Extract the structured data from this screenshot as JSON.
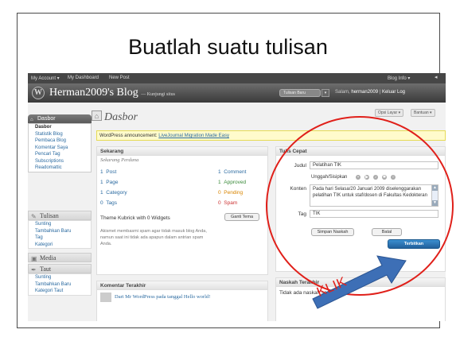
{
  "slide": {
    "title": "Buatlah suatu tulisan",
    "annotation_label": "KLIK",
    "annotation_color": "#e0201a"
  },
  "admin_bar": {
    "links": [
      "My Account ▾",
      "My Dashboard",
      "New Post"
    ],
    "right_link": "Blog Info ▾"
  },
  "header": {
    "logo_icon": "wordpress-logo-icon",
    "blog_title": "Herman2009's Blog",
    "blog_subtitle": "— Kunjungi situs",
    "quick_button": "Tulisan Baru",
    "quick_button_arrow": "▾",
    "user_greeting": "Salam,",
    "user_name": "herman2009",
    "logout": "Keluar Log"
  },
  "menu": {
    "head_label": "Dasbor",
    "items": [
      "Dasbor",
      "Statistik Blog",
      "Pembaca Blog",
      "Komentar Saya",
      "Pencari Tag",
      "Subscriptions",
      "Readomattic"
    ],
    "sections": [
      {
        "icon": "pencil-icon",
        "label": "Tulisan",
        "items": [
          "Sunting",
          "Tambahkan Baru",
          "Tag",
          "Kategori"
        ]
      },
      {
        "icon": "media-icon",
        "label": "Media",
        "items": []
      },
      {
        "icon": "pen-icon",
        "label": "Taut",
        "items": [
          "Sunting",
          "Tambahkan Baru",
          "Kategori Taut"
        ]
      }
    ]
  },
  "main": {
    "page_title": "Dasbor",
    "top_buttons": [
      "Opsi Layar ▾",
      "Bantuan ▾"
    ],
    "notice_prefix": "WordPress announcement:",
    "notice_link": "LiveJournal Migration Made Easy"
  },
  "now_box": {
    "title": "Sekarang",
    "subtitle": "Sekarang Perdana",
    "left_rows": [
      {
        "count": "1",
        "label": "Post"
      },
      {
        "count": "1",
        "label": "Page"
      },
      {
        "count": "1",
        "label": "Category"
      },
      {
        "count": "0",
        "label": "Tags"
      }
    ],
    "right_rows": [
      {
        "count": "1",
        "label": "Comment",
        "color": "#2a6aa0"
      },
      {
        "count": "1",
        "label": "Approved",
        "color": "#3a8a3a"
      },
      {
        "count": "0",
        "label": "Pending",
        "color": "#d98500"
      },
      {
        "count": "0",
        "label": "Spam",
        "color": "#cc3333"
      }
    ],
    "theme_text": "Theme Kubrick with 0 Widgets",
    "theme_button": "Ganti Tema",
    "akismet_text_1": "Akismet membasmi spam agar tidak masuk blog Anda,",
    "akismet_text_2": "namun saat ini tidak ada apapun dalam antrian spam",
    "akismet_text_3": "Anda."
  },
  "comments_box": {
    "title": "Komentar Terakhir",
    "entry": "Dari Mr WordPress pada tanggal Hello world!"
  },
  "quickpress": {
    "title": "Tulis Cepat",
    "judul_label": "Judul",
    "judul_value": "Pelatihan TIK",
    "upload_label": "Unggah/Sisipkan",
    "konten_label": "Konten",
    "konten_value": "Pada hari Selasa/20 Januari 2009 diselenggarakan pelatihan TIK untuk staf/dosen di Fakultas Kedokteran",
    "tag_label": "Tag",
    "tag_value": "TIK",
    "save_button": "Simpan Naskah",
    "reset_button": "Batal",
    "publish_button": "Terbitkan"
  },
  "drafts_box": {
    "title": "Naskah Terakhir",
    "empty_text": "Tidak ada naskah saat ini"
  }
}
